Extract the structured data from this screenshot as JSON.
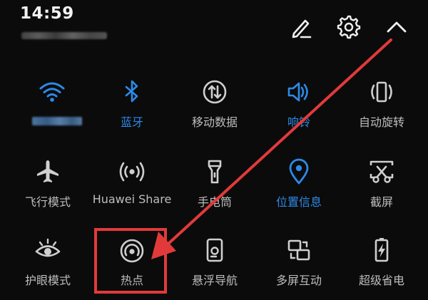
{
  "status_bar": {
    "time": "14:59"
  },
  "header_actions": [
    {
      "name": "edit",
      "icon": "pencil-icon"
    },
    {
      "name": "settings",
      "icon": "gear-icon"
    },
    {
      "name": "collapse",
      "icon": "chevron-up-icon"
    }
  ],
  "tiles": [
    {
      "label": "",
      "icon": "wifi-icon",
      "active": true
    },
    {
      "label": "蓝牙",
      "icon": "bluetooth-icon",
      "active": true
    },
    {
      "label": "移动数据",
      "icon": "mobile-data-icon",
      "active": false
    },
    {
      "label": "响铃",
      "icon": "speaker-icon",
      "active": true
    },
    {
      "label": "自动旋转",
      "icon": "auto-rotate-icon",
      "active": false
    },
    {
      "label": "飞行模式",
      "icon": "airplane-icon",
      "active": false
    },
    {
      "label": "Huawei Share",
      "icon": "huawei-share-icon",
      "active": false
    },
    {
      "label": "手电筒",
      "icon": "flashlight-icon",
      "active": false
    },
    {
      "label": "位置信息",
      "icon": "location-pin-icon",
      "active": true
    },
    {
      "label": "截屏",
      "icon": "screenshot-icon",
      "active": false
    },
    {
      "label": "护眼模式",
      "icon": "eye-icon",
      "active": false
    },
    {
      "label": "热点",
      "icon": "hotspot-icon",
      "active": false
    },
    {
      "label": "悬浮导航",
      "icon": "floating-nav-icon",
      "active": false
    },
    {
      "label": "多屏互动",
      "icon": "multi-screen-icon",
      "active": false
    },
    {
      "label": "超级省电",
      "icon": "battery-saver-icon",
      "active": false
    }
  ],
  "colors": {
    "background": "#0b0b0b",
    "active": "#2c8ae8",
    "inactive": "#c8c8c8",
    "annotation": "#e23a3a"
  }
}
